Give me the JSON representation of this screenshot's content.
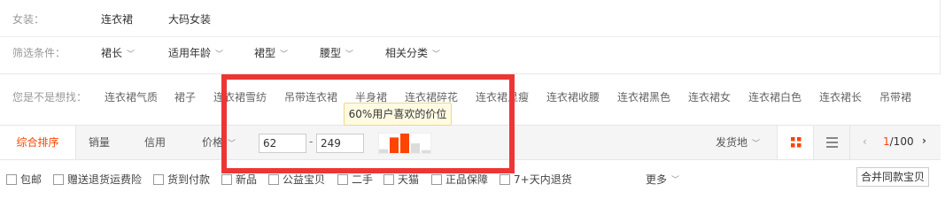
{
  "category": {
    "label": "女装：",
    "items": [
      "连衣裙",
      "大码女装"
    ]
  },
  "filters": {
    "label": "筛选条件：",
    "items": [
      "裙长",
      "适用年龄",
      "裙型",
      "腰型",
      "相关分类"
    ]
  },
  "suggest": {
    "label": "您是不是想找：",
    "items": [
      "连衣裙气质",
      "裙子",
      "连衣裙雪纺",
      "吊带连衣裙",
      "半身裙",
      "连衣裙碎花",
      "连衣裙显瘦",
      "连衣裙收腰",
      "连衣裙黑色",
      "连衣裙女",
      "连衣裙白色",
      "连衣裙长",
      "吊带裙"
    ]
  },
  "sort": {
    "tabs": [
      "综合排序",
      "销量",
      "信用",
      "价格"
    ],
    "price_min": "62",
    "price_max": "249",
    "dash": "-",
    "tooltip": "60%用户喜欢的价位",
    "price_bars": [
      0.2,
      0.8,
      1.0,
      0.5,
      0.15
    ],
    "ship_from": "发货地",
    "page_current": "1",
    "page_total": "/100",
    "accent": "#ff4400"
  },
  "checks": {
    "items": [
      "包邮",
      "赠送退货运费险",
      "货到付款",
      "新品",
      "公益宝贝",
      "二手",
      "天猫",
      "正品保障",
      "7+天内退货"
    ],
    "more": "更多",
    "merge": "合并同款宝贝"
  }
}
